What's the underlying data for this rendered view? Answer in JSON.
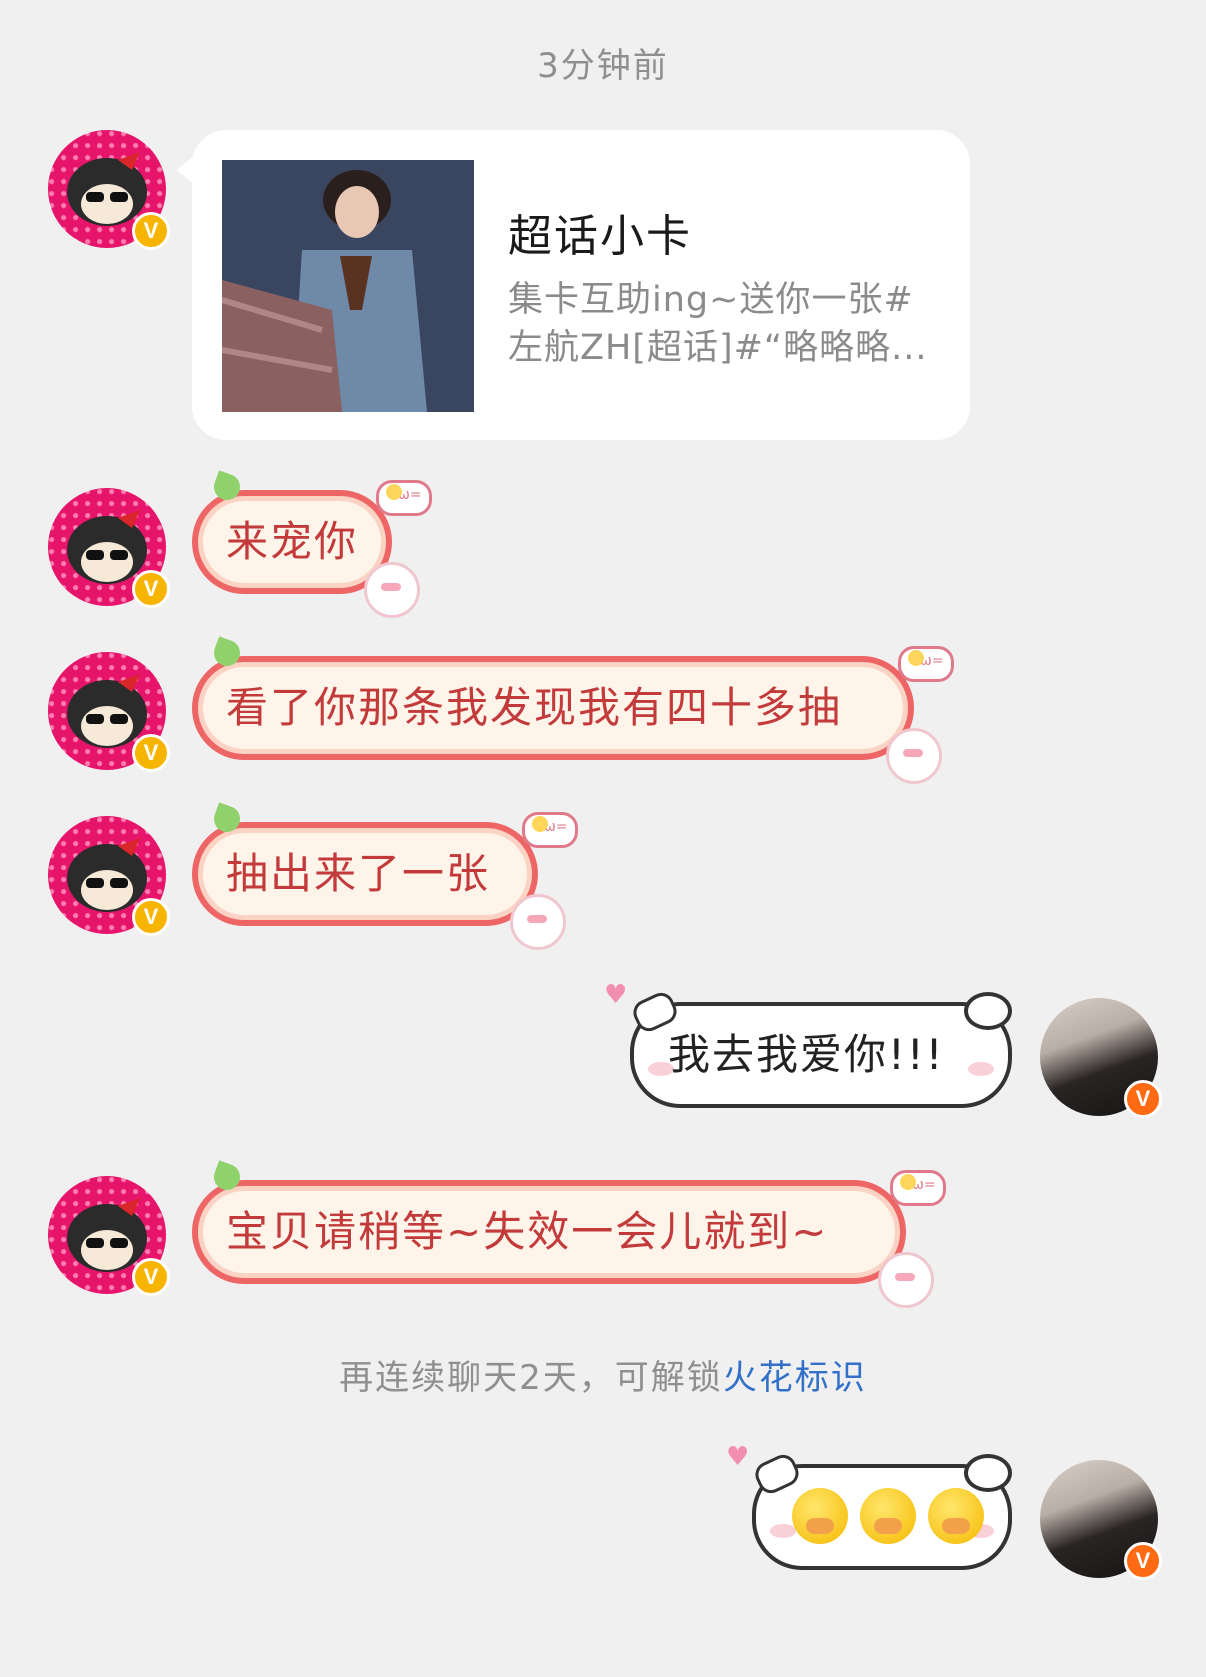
{
  "timestamp": "3分钟前",
  "card": {
    "title": "超话小卡",
    "description": "集卡互助ing~送你一张#左航ZH[超话]#“略略略..."
  },
  "messages": [
    {
      "side": "left",
      "text": "来宠你"
    },
    {
      "side": "left",
      "text": "看了你那条我发现我有四十多抽"
    },
    {
      "side": "left",
      "text": "抽出来了一张"
    },
    {
      "side": "right",
      "text": "我去我爱你!!!"
    },
    {
      "side": "left",
      "text": "宝贝请稍等~失效一会儿就到~"
    }
  ],
  "system_notice": {
    "text": "再连续聊天2天，可解锁",
    "link": "火花标识"
  },
  "last_message": {
    "side": "right",
    "emojis": [
      "cry-emoji",
      "cry-emoji",
      "cry-emoji"
    ]
  },
  "badges": {
    "left": "V",
    "right": "V"
  },
  "colors": {
    "background": "#f0f0f0",
    "peach_border": "#ee6565",
    "peach_text": "#c23a3a",
    "link": "#3370c8",
    "badge_gold": "#f7b500",
    "badge_orange": "#ff6a13"
  }
}
